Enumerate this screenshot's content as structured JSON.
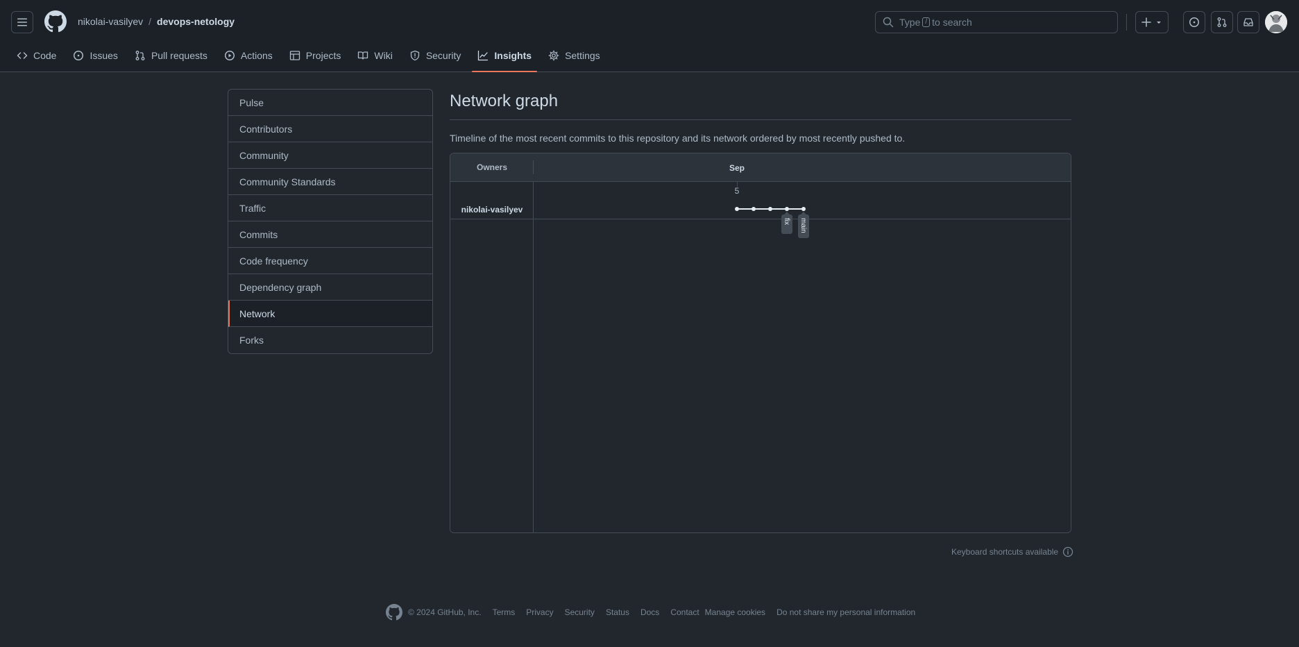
{
  "header": {
    "owner": "nikolai-vasilyev",
    "separator": "/",
    "repo": "devops-netology",
    "search": {
      "prefix": "Type",
      "key": "/",
      "suffix": "to search"
    },
    "icons": [
      "hamburger-icon",
      "github-logo-icon",
      "search-icon",
      "plus-icon",
      "triangle-down-icon",
      "issue-opened-icon",
      "git-pull-request-icon",
      "inbox-icon"
    ]
  },
  "repo_nav": {
    "tabs": [
      {
        "label": "Code",
        "icon": "code-icon"
      },
      {
        "label": "Issues",
        "icon": "issue-opened-icon"
      },
      {
        "label": "Pull requests",
        "icon": "git-pull-request-icon"
      },
      {
        "label": "Actions",
        "icon": "play-icon"
      },
      {
        "label": "Projects",
        "icon": "table-icon"
      },
      {
        "label": "Wiki",
        "icon": "book-icon"
      },
      {
        "label": "Security",
        "icon": "shield-icon"
      },
      {
        "label": "Insights",
        "icon": "graph-icon",
        "active": true
      },
      {
        "label": "Settings",
        "icon": "gear-icon"
      }
    ]
  },
  "sidebar": {
    "items": [
      {
        "label": "Pulse"
      },
      {
        "label": "Contributors"
      },
      {
        "label": "Community"
      },
      {
        "label": "Community Standards"
      },
      {
        "label": "Traffic"
      },
      {
        "label": "Commits"
      },
      {
        "label": "Code frequency"
      },
      {
        "label": "Dependency graph"
      },
      {
        "label": "Network",
        "active": true
      },
      {
        "label": "Forks"
      }
    ]
  },
  "main": {
    "title": "Network graph",
    "description": "Timeline of the most recent commits to this repository and its network ordered by most recently pushed to."
  },
  "network_graph": {
    "owners_header": "Owners",
    "month": "Sep",
    "day": "5",
    "owner": "nikolai-vasilyev",
    "commit_count": 5,
    "branches": [
      {
        "name": "fix",
        "commit_index": 3
      },
      {
        "name": "main",
        "commit_index": 4
      }
    ]
  },
  "keyboard_shortcuts": "Keyboard shortcuts available",
  "footer": {
    "copyright": "© 2024 GitHub, Inc.",
    "links": [
      "Terms",
      "Privacy",
      "Security",
      "Status",
      "Docs",
      "Contact",
      "Manage cookies",
      "Do not share my personal information"
    ]
  },
  "colors": {
    "accent": "#ec775c",
    "background": "#22272e",
    "header_background": "#1c2128",
    "border": "#444c56",
    "text": "#adbac7"
  }
}
